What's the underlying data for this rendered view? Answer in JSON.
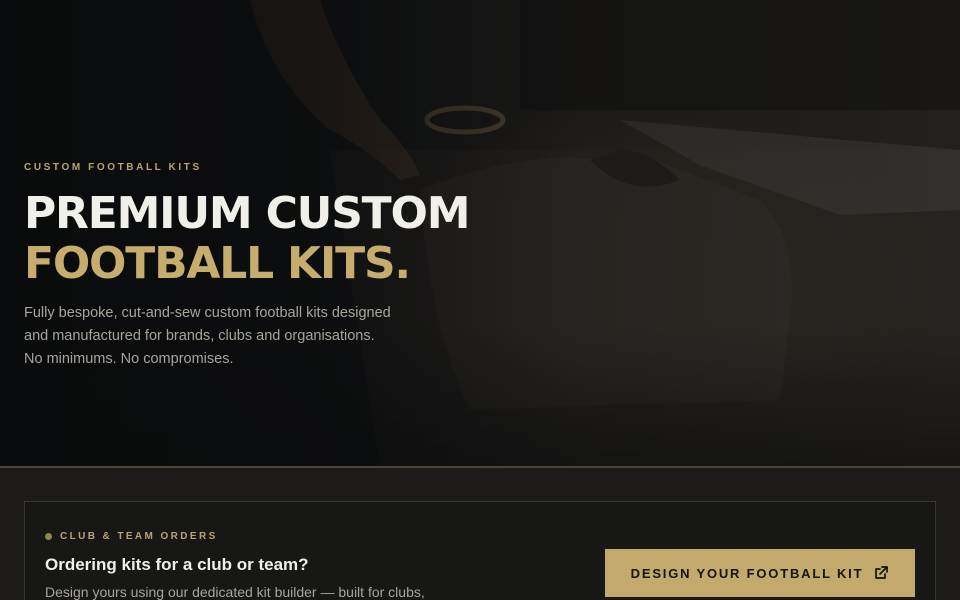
{
  "hero": {
    "eyebrow": "CUSTOM FOOTBALL KITS",
    "title_line1": "PREMIUM CUSTOM",
    "title_line2": "FOOTBALL KITS.",
    "lead_lines": [
      "Fully bespoke, cut-and-sew custom football kits designed",
      "and manufactured for brands, clubs and organisations.",
      "No minimums. No compromises."
    ],
    "image_subject": "workshop-table-with-shirt"
  },
  "club_card": {
    "tag": "CLUB & TEAM ORDERS",
    "title": "Ordering kits for a club or team?",
    "description": "Design yours using our dedicated kit builder — built for clubs,",
    "cta_label": "DESIGN YOUR FOOTBALL KIT",
    "cta_icon": "external-link-icon"
  },
  "colors": {
    "accent_gold": "#c3a96b",
    "background_dark": "#141414",
    "text_light": "#f1efea"
  }
}
